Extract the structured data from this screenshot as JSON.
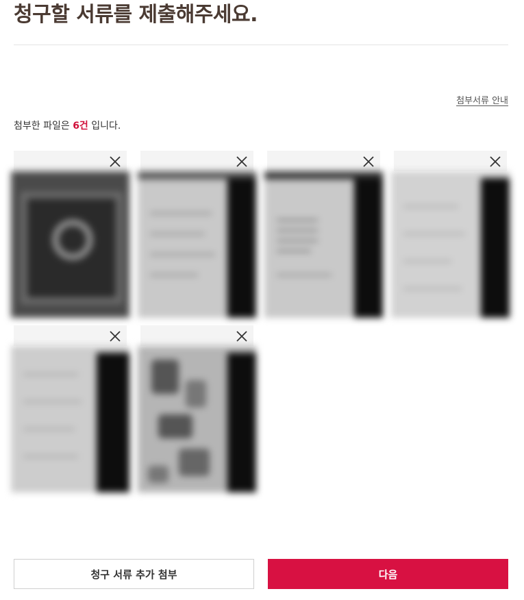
{
  "page": {
    "title": "청구할 서류를 제출해주세요."
  },
  "guide_link": "첨부서류 안내",
  "file_count": {
    "prefix": "첨부한 파일은 ",
    "count": "6건",
    "suffix": " 입니다."
  },
  "attachments": [
    {
      "remove_icon": "close-icon",
      "variant": "dark"
    },
    {
      "remove_icon": "close-icon",
      "variant": "band"
    },
    {
      "remove_icon": "close-icon",
      "variant": "band-dark-top"
    },
    {
      "remove_icon": "close-icon",
      "variant": "band"
    },
    {
      "remove_icon": "close-icon",
      "variant": "band"
    },
    {
      "remove_icon": "close-icon",
      "variant": "patch"
    }
  ],
  "buttons": {
    "add_docs": "청구 서류 추가 첨부",
    "next": "다음"
  },
  "colors": {
    "accent": "#d81142",
    "count_highlight": "#d0103a",
    "title": "#4a3a32"
  }
}
